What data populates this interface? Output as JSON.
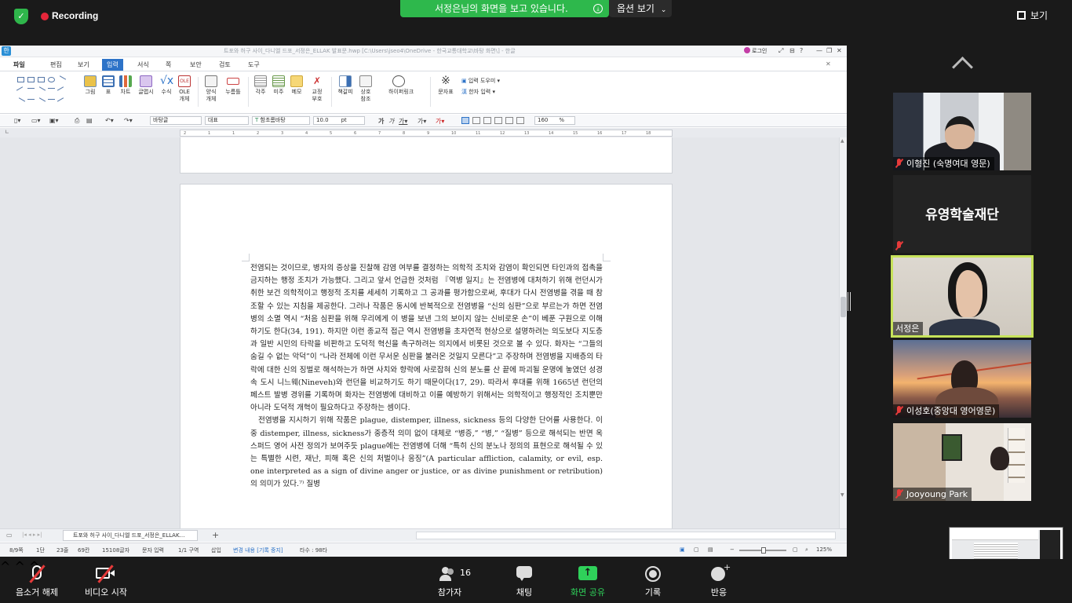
{
  "zoom": {
    "recording_label": "Recording",
    "share_banner": "서정은님의 화면을 보고 있습니다.",
    "options_label": "옵션 보기",
    "view_label": "보기",
    "bottom": {
      "unmute": "음소거 해제",
      "start_video": "비디오 시작",
      "participants": "참가자",
      "participants_count": "16",
      "chat": "채팅",
      "share_screen": "화면 공유",
      "record": "기록",
      "reactions": "반응"
    },
    "participants": [
      {
        "name": "이형진 (숙명여대 영문)"
      },
      {
        "name": "",
        "logo_text": "유영학술재단"
      },
      {
        "name": "서정은"
      },
      {
        "name": "이성호(중앙대 영어영문)"
      },
      {
        "name": "Jooyoung Park"
      }
    ],
    "colors": {
      "accent_green": "#2eb84c",
      "active_border": "#c6e25a",
      "mute_red": "#e53a3a"
    }
  },
  "hwp": {
    "title": "트포와 허구 사이_다니엘 드포_서정은_ELLAK 발표문.hwp [C:\\Users\\jseo4\\OneDrive - 한국교통대학교\\바탕 화면\\] - 한글",
    "login": "로그인",
    "menu": [
      "파일",
      "편집",
      "보기",
      "입력",
      "서식",
      "쪽",
      "보안",
      "검토",
      "도구"
    ],
    "menu_active": "입력",
    "ribbon": {
      "picture": "그림",
      "table": "표",
      "chart": "차트",
      "glyph": "글맵시",
      "equation": "수식",
      "ole": "OLE\n개체",
      "form_object": "양식\n개체",
      "button": "누름틀",
      "footnote": "각주",
      "endnote": "미주",
      "memo": "메모",
      "proof": "교정\n부호",
      "bookmark": "책갈피",
      "cross_ref": "상호\n참조",
      "hyperlink": "하이퍼링크",
      "char_table": "문자표",
      "input_helper": "입력 도우미",
      "hanja_input": "한자 입력"
    },
    "format_bar": {
      "style": "바탕글",
      "lang": "대표",
      "font": "함초롬바탕",
      "size": "10.0",
      "size_unit": "pt",
      "zoom": "160",
      "zoom_unit": "%"
    },
    "ruler_ticks": [
      "2",
      "1",
      "1",
      "2",
      "3",
      "4",
      "5",
      "6",
      "7",
      "8",
      "9",
      "10",
      "11",
      "12",
      "13",
      "14",
      "15",
      "16",
      "17",
      "18"
    ],
    "page_text": [
      "전염되는 것이므로, 병자의 증상을 진찰해 감염 여부를 결정하는 의학적 조치와 감염이 확인되면 타인과의 접촉을 금지하는 행정 조치가 가능했다. 그리고 앞서 언급한 것처럼 『역병 일지』는 전염병에 대처하기 위해 런던시가 취한 보건 의학적이고 행정적 조치를 세세히 기록하고 그 공과를 평가함으로써, 후대가 다시 전염병을 겪을 때 참조할 수 있는 지침을 제공한다. 그러나 작품은 동시에 반복적으로 전염병을 “신의 심판”으로 부르는가 하면 전염병의 소멸 역시 “처음 심판을 위해 우리에게 이 병을 보낸 그의 보이지 않는 신비로운 손”이 베푼 구원으로 이해하기도 한다(34, 191). 하지만 이런 종교적 접근 역시 전염병을 초자연적 현상으로 설명하려는 의도보다 지도층과 일반 시민의 타락을 비판하고 도덕적 혁신을 촉구하려는 의지에서 비롯된 것으로 볼 수 있다. 화자는 “그들의 숨길 수 없는 악덕”이 “나라 전체에 이런 무서운 심판을 불러온 것일지 모른다”고 주장하며 전염병을 지배층의 타락에 대한 신의 징벌로 해석하는가 하면 사치와 향락에 사로잡혀 신의 분노를 산 끝에 파괴될 운명에 놓였던 성경 속 도시 니느웨(Nineveh)와 런던을 비교하기도 하기 때문이다(17, 29). 따라서 후대를 위해 1665년 런던의 페스트 발병 경위를 기록하며 화자는 전염병에 대비하고 이를 예방하기 위해서는 의학적이고 행정적인 조치뿐만 아니라 도덕적 개혁이 필요하다고 주장하는 셈이다.",
      "전염병을 지시하기 위해 작품은 plague, distemper, illness, sickness 등의 다양한 단어를 사용한다. 이중 distemper, illness, sickness가 중층적 의미 없이 대체로 “병증,” “병,” “질병” 등으로 해석되는 반면 옥스퍼드 영어 사전 정의가 보여주듯 plague에는 전염병에 더해 “특히 신의 분노나 정의의 표현으로 해석될 수 있는 특별한 시련, 재난, 피해 혹은 신의 처벌이나 응징”(A particular affliction, calamity, or evil, esp. one interpreted as a sign of divine anger or justice, or as divine punishment or retribution)의 의미가 있다.⁷⁾ 질병"
    ],
    "tab_label": "트포와 허구 사이_다니엘 드포_서정은_ELLAK…",
    "status": {
      "page": "8/9쪽",
      "section": "1단",
      "line": "23줄",
      "column": "69칸",
      "chars": "15108글자",
      "input_mode": "문자 입력",
      "zone": "1/1 구역",
      "insert": "삽입",
      "track": "변경 내용 [기록 중지]",
      "keystrokes": "타수 : 98타",
      "zoom": "125%"
    }
  }
}
